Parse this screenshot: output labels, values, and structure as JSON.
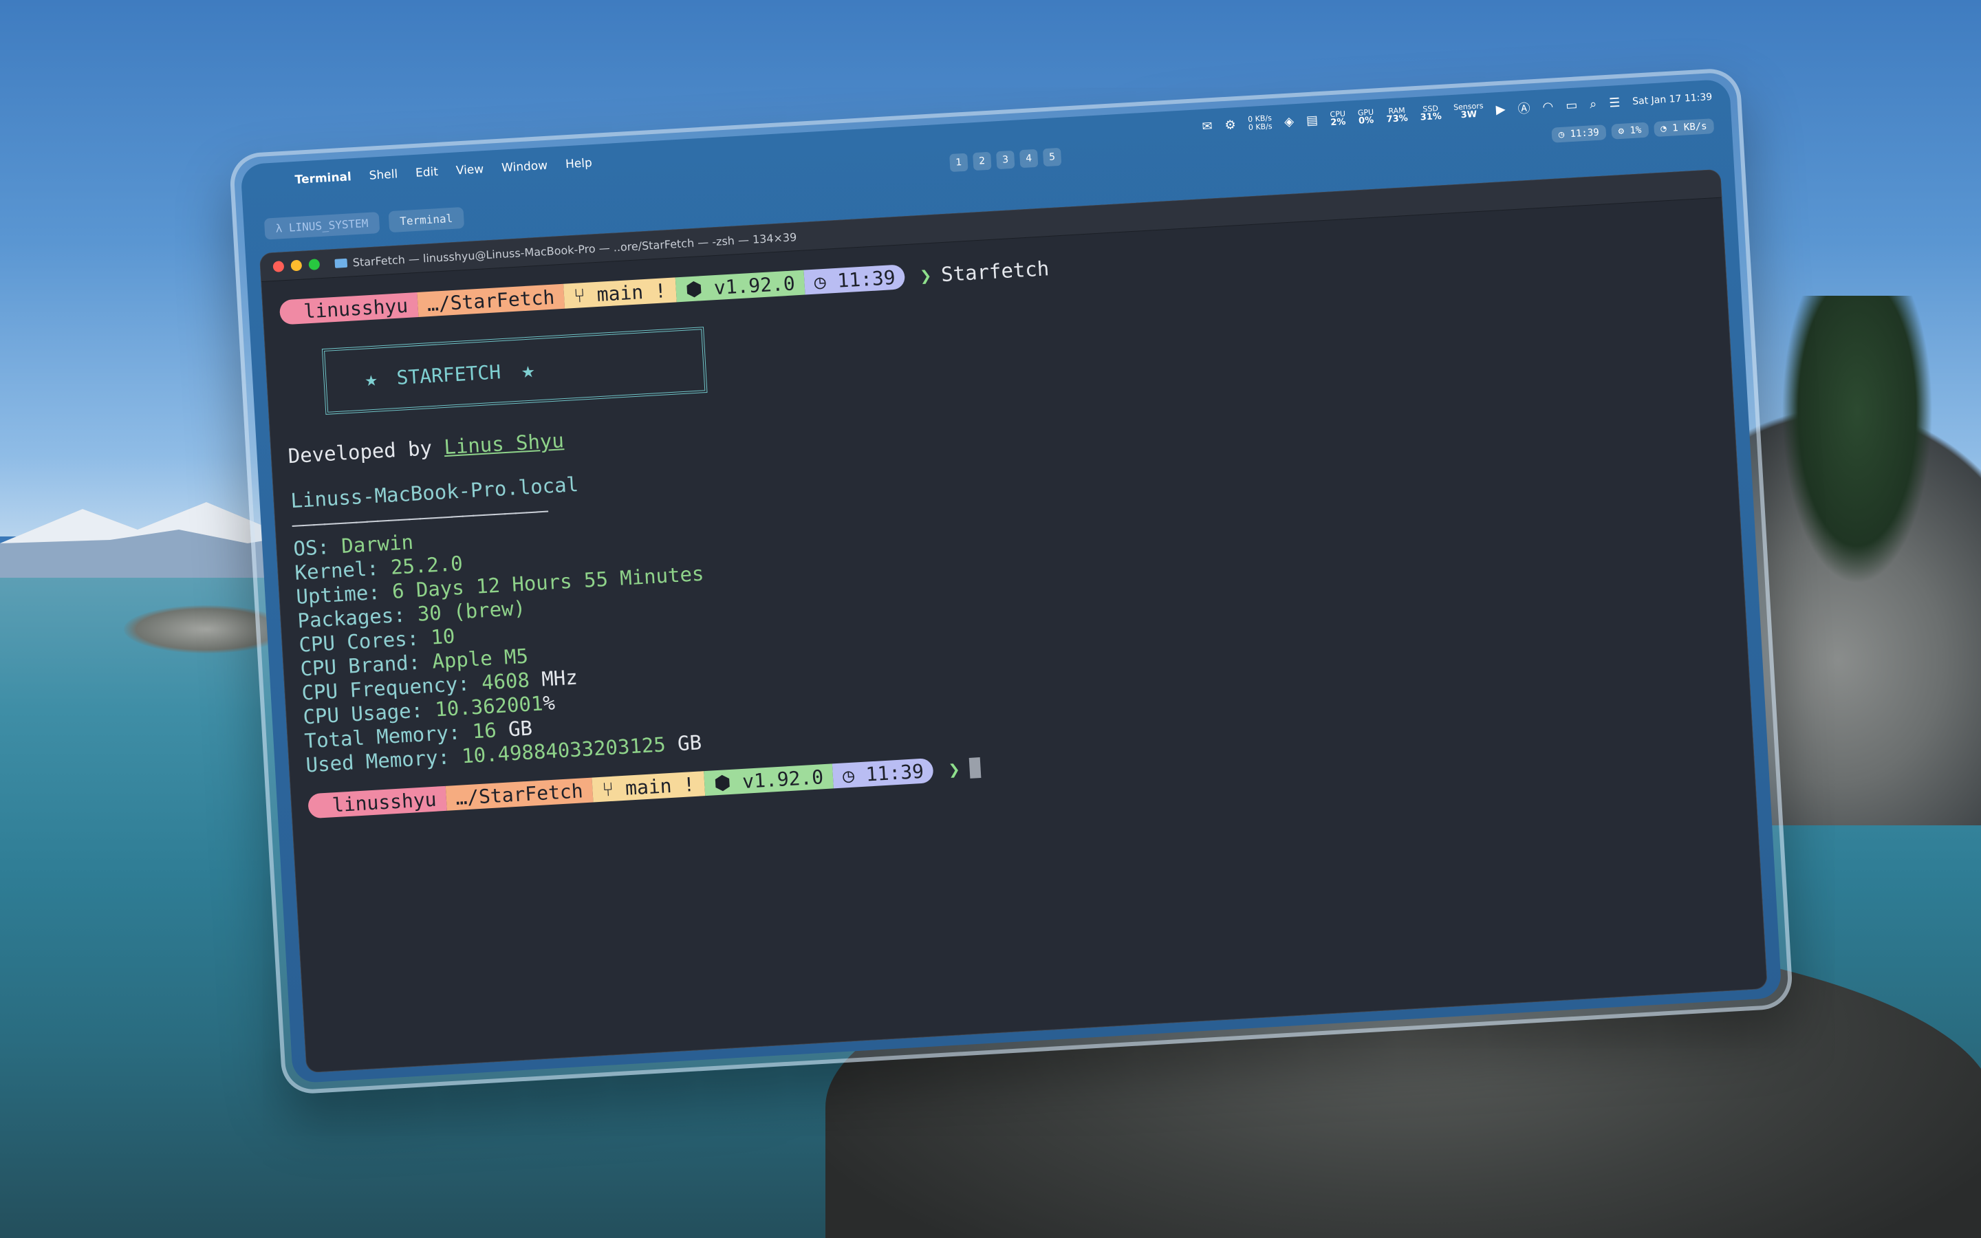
{
  "menubar": {
    "app": "Terminal",
    "items": [
      "Shell",
      "Edit",
      "View",
      "Window",
      "Help"
    ],
    "spaces": [
      "1",
      "2",
      "3",
      "4",
      "5"
    ],
    "net_up": "0 KB/s",
    "net_down": "0 KB/s",
    "cpu": {
      "label": "CPU",
      "value": "2%"
    },
    "gpu": {
      "label": "GPU",
      "value": "0%"
    },
    "ram": {
      "label": "RAM",
      "value": "73%"
    },
    "ssd": {
      "label": "SSD",
      "value": "31%"
    },
    "sensors": {
      "label": "Sensors",
      "value": "3W"
    },
    "clock": "Sat Jan 17  11:39",
    "pills": [
      "11:39",
      "1%",
      "1 KB/s"
    ]
  },
  "tabs": [
    {
      "label": "λ LINUS_SYSTEM"
    },
    {
      "label": "Terminal"
    }
  ],
  "window": {
    "title": "StarFetch — linusshyu@Linuss-MacBook-Pro — ..ore/StarFetch — -zsh — 134×39"
  },
  "prompt": {
    "user": "linusshyu",
    "path": "…/StarFetch",
    "git": "main !",
    "version": "v1.92.0",
    "time": "11:39",
    "arrow": "❯",
    "command": "Starfetch"
  },
  "logo": {
    "star": "★",
    "name": "STARFETCH"
  },
  "developer": {
    "prefix": "Developed by",
    "name": "Linus Shyu"
  },
  "host": "Linuss-MacBook-Pro.local",
  "separator": "————————————————————————",
  "info": [
    {
      "label": "OS:",
      "value": "Darwin",
      "unit": ""
    },
    {
      "label": "Kernel:",
      "value": "25.2.0",
      "unit": ""
    },
    {
      "label": "Uptime:",
      "value": "6 Days 12 Hours 55 Minutes",
      "unit": ""
    },
    {
      "label": "Packages:",
      "value": "30 (brew)",
      "unit": ""
    },
    {
      "label": "CPU Cores:",
      "value": "10",
      "unit": ""
    },
    {
      "label": "CPU Brand:",
      "value": "Apple M5",
      "unit": ""
    },
    {
      "label": "CPU Frequency:",
      "value": "4608",
      "unit": "MHz"
    },
    {
      "label": "CPU Usage:",
      "value": "10.362001",
      "unit": "%"
    },
    {
      "label": "Total Memory:",
      "value": "16",
      "unit": "GB"
    },
    {
      "label": "Used Memory:",
      "value": "10.49884033203125",
      "unit": "GB"
    }
  ],
  "colors": {
    "terminal_bg": "#262b35",
    "seg_user": "#f08aa4",
    "seg_path": "#f6ac80",
    "seg_git": "#f7d99a",
    "seg_version": "#9fdc9b",
    "seg_time": "#b9bdf3",
    "accent_green": "#8fd38a",
    "accent_cyan": "#8fd0d2"
  }
}
